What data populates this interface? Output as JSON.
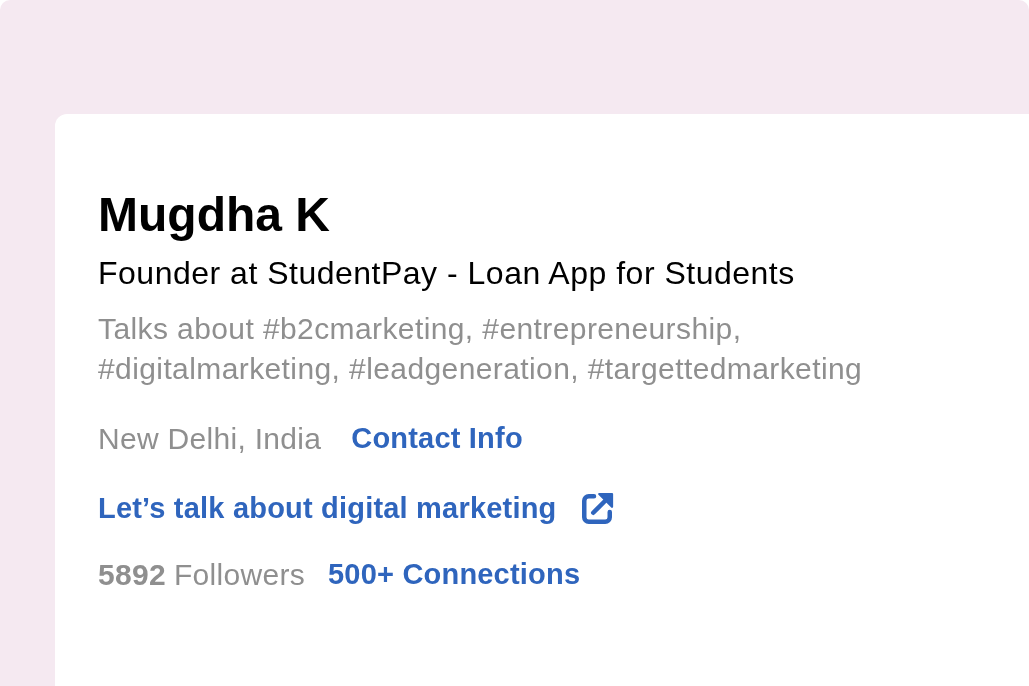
{
  "profile": {
    "name": "Mugdha K",
    "headline": "Founder at StudentPay - Loan App for Students",
    "talks_about": "Talks about #b2cmarketing, #entrepreneurship, #digitalmarketing, #leadgeneration, #targettedmarketing",
    "location": "New Delhi, India",
    "contact_link": "Contact Info",
    "website_link": "Let’s talk about digital marketing",
    "followers_count": "5892",
    "followers_label": "Followers",
    "connections_link": "500+ Connections"
  }
}
